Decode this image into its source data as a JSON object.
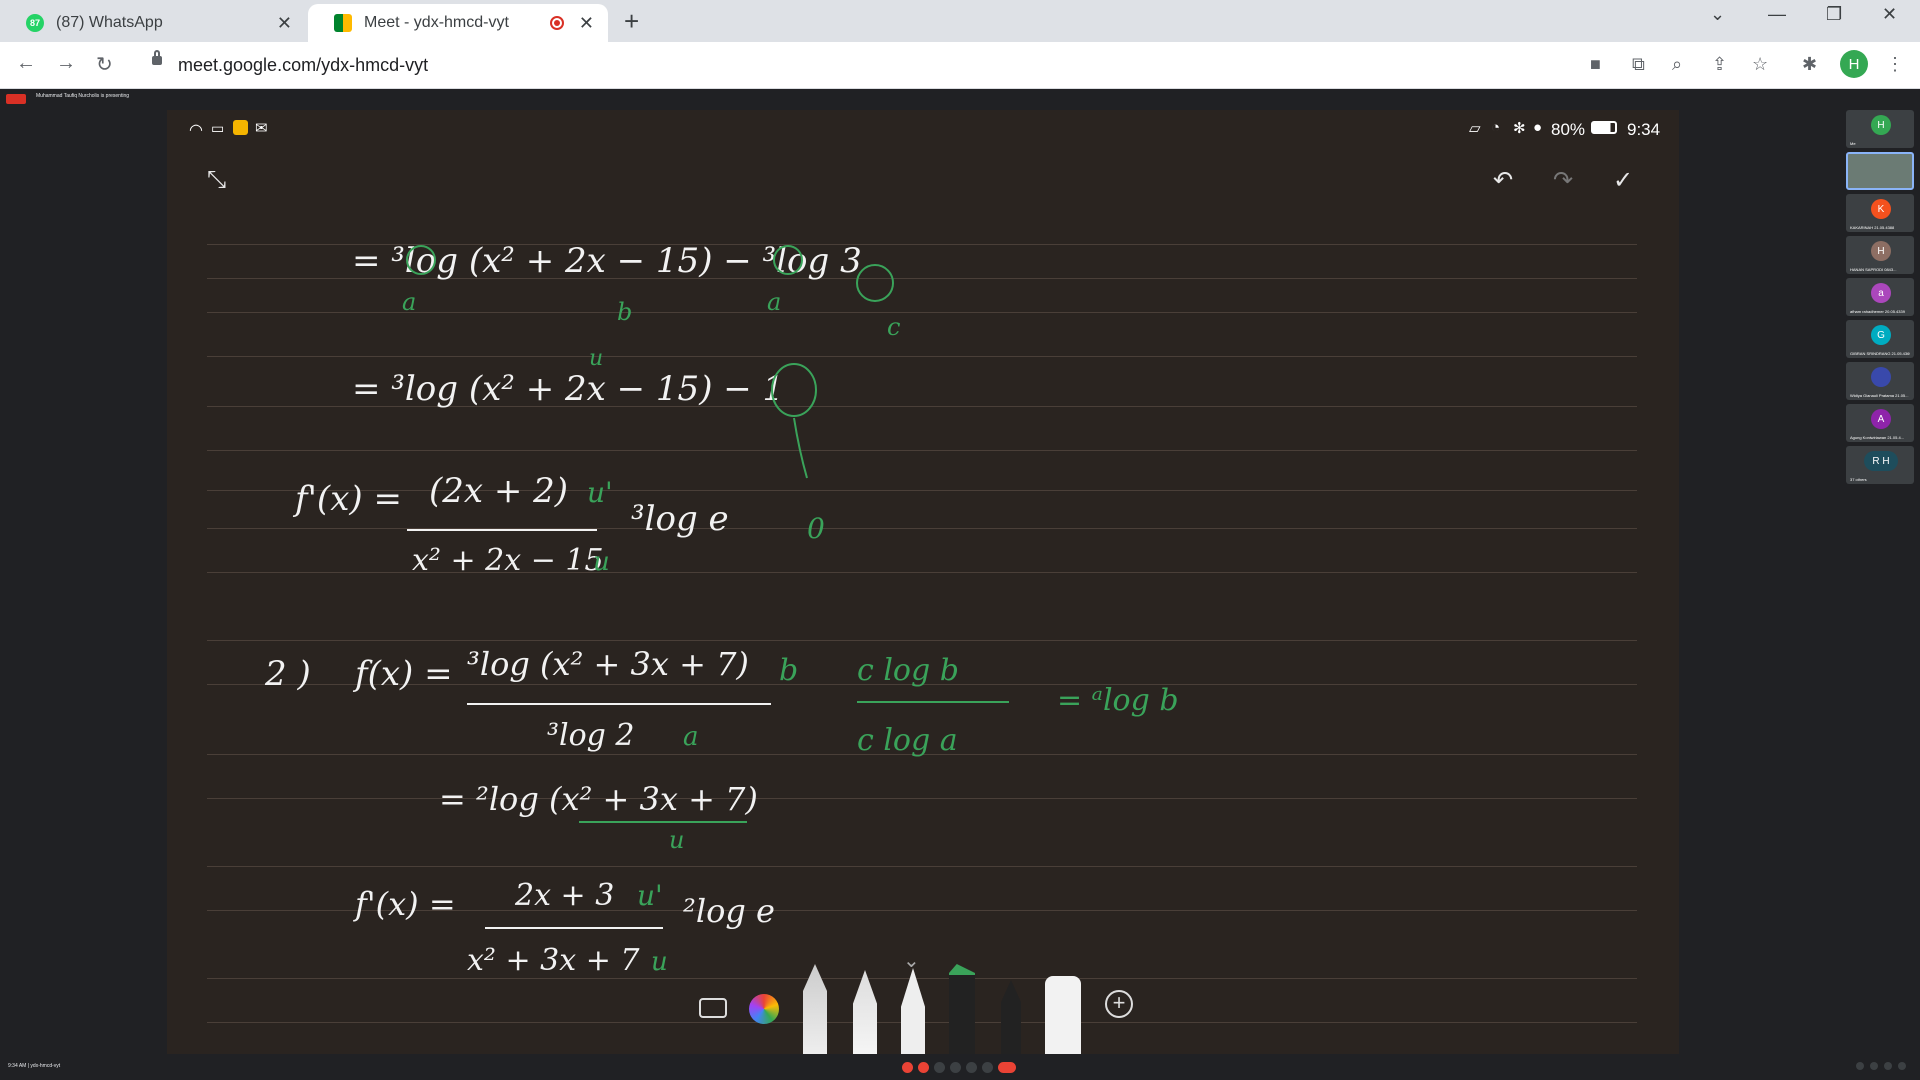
{
  "browser": {
    "tabs": [
      {
        "title": "(87) WhatsApp",
        "badge": "87",
        "active": false
      },
      {
        "title": "Meet - ydx-hmcd-vyt",
        "active": true
      }
    ],
    "url": "meet.google.com/ydx-hmcd-vyt",
    "profile_initial": "H"
  },
  "device_status": {
    "battery": "80%",
    "time": "9:34"
  },
  "meet": {
    "presenter_text": "Muhammad Taufiq Nurcholis is presenting",
    "meeting_info": "9:34 AM | ydx-hmcd-vyt",
    "participants": [
      {
        "initial": "H",
        "color": "#34a853",
        "name": "Me"
      },
      {
        "initial": "",
        "color": "#6b7b74",
        "name": "",
        "video": true
      },
      {
        "initial": "K",
        "color": "#f4511e",
        "name": "KAKARINAH 21.05.4388"
      },
      {
        "initial": "H",
        "color": "#8d6e63",
        "name": "HANAN SAPRODI 0843..."
      },
      {
        "initial": "a",
        "color": "#ab47bc",
        "name": "afham rahadhemer 20.05.4339"
      },
      {
        "initial": "G",
        "color": "#00acc1",
        "name": "GIBRAN SRINDRANG 21.05.4369"
      },
      {
        "initial": "",
        "color": "#3949ab",
        "name": "Widiya Gianauli Pratama 21.05..."
      },
      {
        "initial": "A",
        "color": "#8e24aa",
        "name": "Agung Koniwiriawan 21.05.4..."
      },
      {
        "initial": "R H",
        "color": "#1e4d5c",
        "name": "37 others"
      }
    ]
  },
  "whiteboard": {
    "line1": "= ³log (x² + 2x − 15) − ³log 3",
    "line1_labels": [
      "a",
      "b",
      "a",
      "c"
    ],
    "line2": "= ³log (x² + 2x − 15) − 1",
    "line2_label": "u",
    "line3_num": "(2x + 2)",
    "line3_den": "x² + 2x − 15",
    "line3_lhs": "f'(x) =",
    "line3_tail": "³log e",
    "line3_u1": "u'",
    "line3_u": "u",
    "zero": "0",
    "p2_label": "2 )",
    "p2_lhs": "f(x) =",
    "p2_num": "³log (x² + 3x + 7)",
    "p2_den": "³log 2",
    "p2_b": "b",
    "p2_a": "a",
    "rule_num": "c log b",
    "rule_den": "c log a",
    "rule_rhs": "= ᵃlog b",
    "p2_simpl": "= ²log (x² + 3x + 7)",
    "p2_u": "u",
    "p2_deriv_lhs": "f'(x) =",
    "p2_deriv_num": "2x + 3",
    "p2_deriv_den": "x² + 3x + 7",
    "p2_deriv_tail": "²log e",
    "p2_u1": "u'",
    "p2_u2": "u"
  },
  "colors": {
    "ink_white": "#f2f2f2",
    "ink_green": "#3aa35a",
    "board": "#2a2420"
  },
  "pen_tools": [
    "keyboard-icon",
    "color-picker-icon",
    "pencil-icon",
    "fountain-pen-icon",
    "marker-icon",
    "highlighter-icon",
    "calligraphy-icon",
    "eraser-icon",
    "add-icon"
  ]
}
